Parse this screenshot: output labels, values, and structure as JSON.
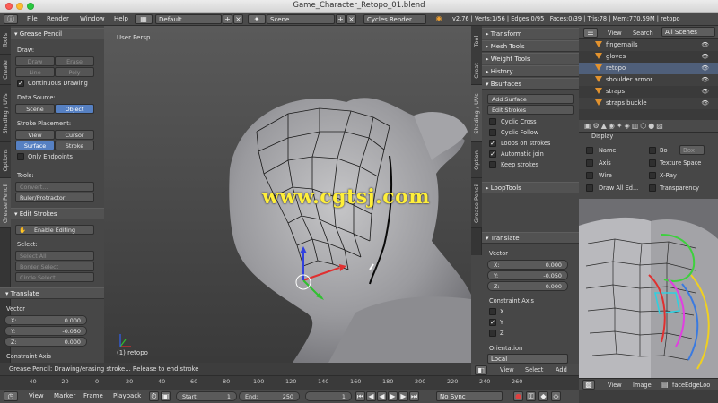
{
  "window": {
    "title": "Game_Character_Retopo_01.blend"
  },
  "info_header": {
    "menus": [
      "File",
      "Render",
      "Window",
      "Help"
    ],
    "layout": "Default",
    "scene": "Scene",
    "engine": "Cycles Render",
    "stats": "v2.76 | Verts:1/56 | Edges:0/95 | Faces:0/39 | Tris:78 | Mem:770.59M | retopo"
  },
  "left_tabs": [
    "Tools",
    "Create",
    "Shading / UVs",
    "Options",
    "Grease Pencil"
  ],
  "toolshelf": {
    "grease_pencil": {
      "header": "Grease Pencil",
      "draw_label": "Draw:",
      "draw": "Draw",
      "erase": "Erase",
      "line": "Line",
      "poly": "Poly",
      "continuous_drawing": "Continuous Drawing",
      "data_source_label": "Data Source:",
      "scene": "Scene",
      "object": "Object",
      "stroke_placement_label": "Stroke Placement:",
      "view": "View",
      "cursor": "Cursor",
      "surface": "Surface",
      "stroke": "Stroke",
      "only_endpoints": "Only Endpoints",
      "tools_label": "Tools:",
      "convert": "Convert...",
      "ruler": "Ruler/Protractor"
    },
    "edit_strokes": {
      "header": "Edit Strokes",
      "enable_editing": "Enable Editing",
      "select_label": "Select:",
      "select_all": "Select All",
      "border_select": "Border Select",
      "circle_select": "Circle Select"
    },
    "translate": {
      "header": "Translate",
      "vector_label": "Vector",
      "x_label": "X:",
      "x": "0.000",
      "y_label": "Y:",
      "y": "-0.050",
      "z_label": "Z:",
      "z": "0.000",
      "constraint_axis": "Constraint Axis"
    }
  },
  "viewport": {
    "view_label": "User Persp",
    "object_label": "(1) retopo",
    "status": "Grease Pencil: Drawing/erasing stroke... Release to end stroke",
    "watermark": "www.cgtsj.com"
  },
  "n_tabs": [
    "Tool",
    "Creat",
    "Shading / UVs",
    "Option",
    "Grease Pencil"
  ],
  "n_panel": {
    "transform": "Transform",
    "mesh_tools": "Mesh Tools",
    "weight_tools": "Weight Tools",
    "history": "History",
    "bsurfaces": "Bsurfaces",
    "add_surface": "Add Surface",
    "edit_strokes": "Edit Strokes",
    "cyclic_cross": "Cyclic Cross",
    "cyclic_follow": "Cyclic Follow",
    "loops_on_strokes": "Loops on strokes",
    "automatic_join": "Automatic join",
    "keep_strokes": "Keep strokes",
    "looptools": "LoopTools",
    "translate": "Translate",
    "vector_label": "Vector",
    "x_label": "X:",
    "x": "0.000",
    "y_label": "Y:",
    "y": "-0.050",
    "z_label": "Z:",
    "z": "0.000",
    "constraint_axis": "Constraint Axis",
    "cx": "X",
    "cy": "Y",
    "cz": "Z",
    "orientation_label": "Orientation",
    "orientation": "Local",
    "footer_view": "View",
    "footer_select": "Select",
    "footer_add": "Add"
  },
  "outliner": {
    "view": "View",
    "search": "Search",
    "all_scenes": "All Scenes",
    "rows": [
      "fingernails",
      "gloves",
      "retopo",
      "shoulder armor",
      "straps",
      "straps buckle"
    ]
  },
  "properties": {
    "display": "Display",
    "name": "Name",
    "axis": "Axis",
    "wire": "Wire",
    "draw_all_edges": "Draw All Ed...",
    "bounds": "Bo",
    "box": "Box",
    "texture_space": "Texture Space",
    "xray": "X-Ray",
    "transparency": "Transparency"
  },
  "uv_editor": {
    "view": "View",
    "image": "Image",
    "image_name": "faceEdgeLoo"
  },
  "timeline": {
    "ticks": [
      "-40",
      "-20",
      "0",
      "20",
      "40",
      "60",
      "80",
      "100",
      "120",
      "140",
      "160",
      "180",
      "200",
      "220",
      "240",
      "260"
    ],
    "view": "View",
    "marker": "Marker",
    "frame": "Frame",
    "playback": "Playback",
    "start_label": "Start:",
    "start": "1",
    "end_label": "End:",
    "end": "250",
    "current": "1",
    "sync": "No Sync"
  },
  "colors": {
    "accent": "#5680c2",
    "grease_stroke": "#ffffff",
    "watermark": "#ffef3a",
    "mesh_tri": "#e2922e"
  }
}
